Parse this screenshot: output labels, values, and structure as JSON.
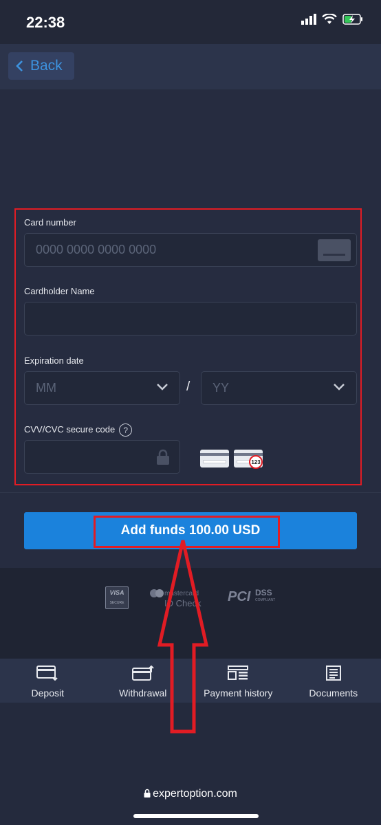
{
  "status_bar": {
    "time": "22:38"
  },
  "nav": {
    "back_label": "Back"
  },
  "form": {
    "card_number_label": "Card number",
    "card_number_placeholder": "0000 0000 0000 0000",
    "cardholder_label": "Cardholder Name",
    "cardholder_value": "",
    "expiration_label": "Expiration date",
    "month_placeholder": "MM",
    "year_placeholder": "YY",
    "separator": "/",
    "cvv_label": "CVV/CVC secure code",
    "help_glyph": "?",
    "cvv_value": "",
    "cvv_example": "123"
  },
  "add_funds_label": "Add funds 100.00 USD",
  "logos": {
    "visa_top": "VISA",
    "visa_bottom": "SECURE",
    "mc_line1": "mastercard",
    "mc_line2": "ID Check",
    "pci": "PCI",
    "dss": "DSS",
    "dss_small": "COMPLIANT"
  },
  "tabs": [
    {
      "label": "Deposit",
      "icon": "deposit-card-icon"
    },
    {
      "label": "Withdrawal",
      "icon": "withdrawal-card-icon"
    },
    {
      "label": "Payment history",
      "icon": "payment-history-icon"
    },
    {
      "label": "Documents",
      "icon": "documents-icon"
    }
  ],
  "footer": {
    "url": "expertoption.com"
  },
  "colors": {
    "accent_blue": "#1b82dc",
    "highlight_red": "#e11c24",
    "background": "#242a3d"
  }
}
